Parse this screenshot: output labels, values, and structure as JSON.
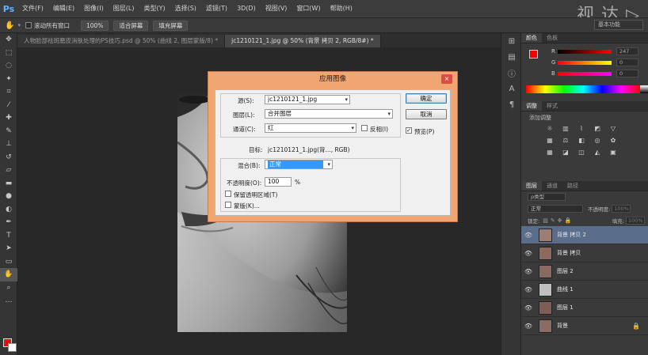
{
  "app": {
    "logo": "Ps",
    "watermark": "视 达 ▷"
  },
  "menu": [
    "文件(F)",
    "编辑(E)",
    "图像(I)",
    "图层(L)",
    "类型(Y)",
    "选择(S)",
    "滤镜(T)",
    "3D(D)",
    "视图(V)",
    "窗口(W)",
    "帮助(H)"
  ],
  "options_bar": {
    "scroll_all_label": "滚动所有窗口",
    "zoom_100": "100%",
    "fit_screen": "适合屏幕",
    "fill_screen": "填充屏幕",
    "workspace": "基本功能"
  },
  "doc_tabs": [
    {
      "label": "人物脸部祛斑磨皮消肤处理的PS技巧.psd @ 50% (曲线 2, 图层蒙版/8) *",
      "active": false
    },
    {
      "label": "jc1210121_1.jpg @ 50% (背景 拷贝 2, RGB/8#) *",
      "active": true
    }
  ],
  "color_panel": {
    "tabs": [
      "颜色",
      "色板"
    ],
    "r_label": "R",
    "r_value": "247",
    "g_label": "G",
    "g_value": "0",
    "b_label": "B",
    "b_value": "0"
  },
  "adjust_panel": {
    "tabs": [
      "调整",
      "样式"
    ],
    "title": "添加调整"
  },
  "layers_panel": {
    "tabs": [
      "图层",
      "通道",
      "路径"
    ],
    "filter": "ρ类型",
    "blend_mode": "正常",
    "opacity_label": "不透明度:",
    "opacity_value": "100%",
    "lock_label": "锁定:",
    "fill_label": "填充:",
    "fill_value": "100%",
    "layers": [
      {
        "name": "背景 拷贝 2",
        "selected": true,
        "lock": false
      },
      {
        "name": "背景 拷贝",
        "selected": false,
        "lock": false
      },
      {
        "name": "图层 2",
        "selected": false,
        "lock": false
      },
      {
        "name": "曲线 1",
        "selected": false,
        "lock": false
      },
      {
        "name": "图层 1",
        "selected": false,
        "lock": false
      },
      {
        "name": "背景",
        "selected": false,
        "lock": true
      }
    ]
  },
  "dialog": {
    "title": "应用图像",
    "source_label": "源(S):",
    "source_value": "jc1210121_1.jpg",
    "layer_label": "图层(L):",
    "layer_value": "合并图层",
    "channel_label": "通道(C):",
    "channel_value": "红",
    "invert_label": "反相(I)",
    "target_label": "目标:",
    "target_value": "jc1210121_1.jpg(背..., RGB)",
    "blending_label": "混合(B):",
    "blending_value": "正常",
    "opacity_label": "不透明度(O):",
    "opacity_value": "100",
    "opacity_unit": "%",
    "preserve_label": "保留透明区域(T)",
    "mask_label": "蒙版(K)...",
    "ok_label": "确定",
    "cancel_label": "取消",
    "preview_label": "预览(P)",
    "close_glyph": "×"
  }
}
